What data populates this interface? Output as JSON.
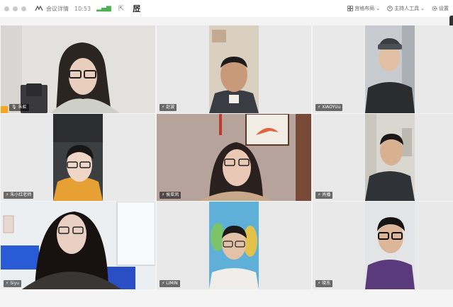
{
  "titlebar": {
    "meeting_info_label": "会议详情",
    "time": "10:53",
    "rec_label": "㞐",
    "layout_label": "宫格布局",
    "host_tools_label": "主持人工具",
    "settings_label": "设置"
  },
  "participants": [
    {
      "name": "朱虹",
      "host": true,
      "active": true
    },
    {
      "name": "赵波"
    },
    {
      "name": "XIAOYUu"
    },
    {
      "name": "朱小红老师"
    },
    {
      "name": "侯亚凤"
    },
    {
      "name": "肖播"
    },
    {
      "name": "Siyu"
    },
    {
      "name": "LIMIN"
    },
    {
      "name": "晓东"
    }
  ],
  "colors": {
    "active_border": "#4cbf74",
    "host_badge": "#f5a623",
    "tile_bg": "#e9e9e9"
  }
}
